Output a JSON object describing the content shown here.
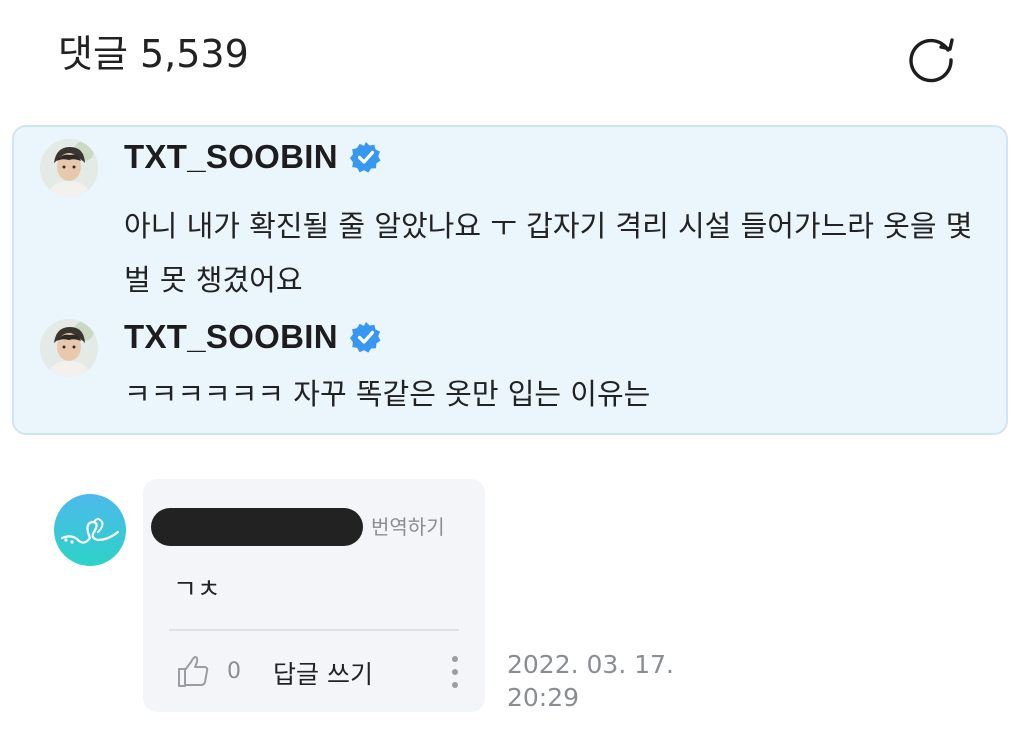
{
  "header": {
    "title": "댓글 5,539",
    "refresh_icon": "refresh-icon"
  },
  "pinned": {
    "background": "#eaf5fc",
    "border": "#cfe6f3",
    "comments": [
      {
        "username": "TXT_SOOBIN",
        "verified": true,
        "text": "아니 내가 확진될 줄 알았나요 ㅜ 갑자기 격리 시설 들어가느라 옷을 몇 벌 못 챙겼어요"
      },
      {
        "username": "TXT_SOOBIN",
        "verified": true,
        "text": "ㅋㅋㅋㅋㅋㅋ 자꾸 똑같은 옷만 입는 이유는"
      }
    ]
  },
  "comment": {
    "translate_label": "번역하기",
    "text": "ㄱㅊ",
    "like_count": "0",
    "reply_label": "답글 쓰기",
    "date": "2022. 03. 17.",
    "time": "20:29",
    "like_icon": "thumbs-up-icon",
    "more_icon": "more-vertical-icon"
  },
  "colors": {
    "verified_badge": "#3897f0",
    "muted_text": "#8a8d93",
    "card_background": "#f4f5f8"
  }
}
